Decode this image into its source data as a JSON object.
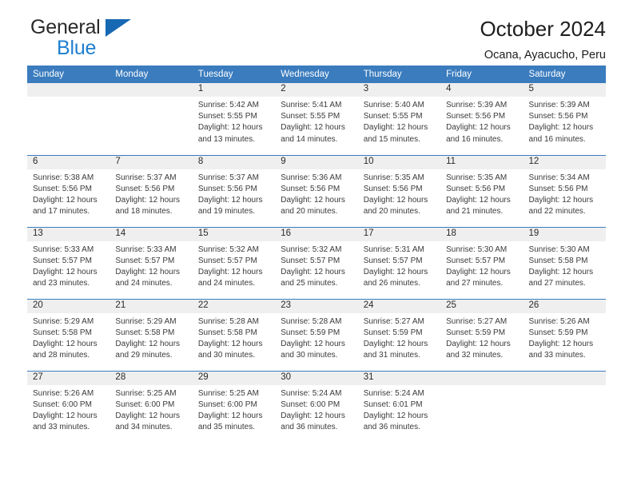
{
  "brand": {
    "name_top": "General",
    "name_bottom": "Blue",
    "triangle_color": "#1668b3",
    "blue_color": "#1f7fd0"
  },
  "header": {
    "title": "October 2024",
    "subtitle": "Ocana, Ayacucho, Peru"
  },
  "theme": {
    "header_blue": "#3a7cbe",
    "daynum_band": "#efefef",
    "text": "#3a3a3a"
  },
  "weekday_headers": [
    "Sunday",
    "Monday",
    "Tuesday",
    "Wednesday",
    "Thursday",
    "Friday",
    "Saturday"
  ],
  "labels": {
    "sunrise_prefix": "Sunrise: ",
    "sunset_prefix": "Sunset: ",
    "daylight_prefix": "Daylight: "
  },
  "weeks": [
    [
      {
        "empty": true
      },
      {
        "empty": true
      },
      {
        "day": "1",
        "sunrise": "Sunrise: 5:42 AM",
        "sunset": "Sunset: 5:55 PM",
        "daylight_1": "Daylight: 12 hours",
        "daylight_2": "and 13 minutes."
      },
      {
        "day": "2",
        "sunrise": "Sunrise: 5:41 AM",
        "sunset": "Sunset: 5:55 PM",
        "daylight_1": "Daylight: 12 hours",
        "daylight_2": "and 14 minutes."
      },
      {
        "day": "3",
        "sunrise": "Sunrise: 5:40 AM",
        "sunset": "Sunset: 5:55 PM",
        "daylight_1": "Daylight: 12 hours",
        "daylight_2": "and 15 minutes."
      },
      {
        "day": "4",
        "sunrise": "Sunrise: 5:39 AM",
        "sunset": "Sunset: 5:56 PM",
        "daylight_1": "Daylight: 12 hours",
        "daylight_2": "and 16 minutes."
      },
      {
        "day": "5",
        "sunrise": "Sunrise: 5:39 AM",
        "sunset": "Sunset: 5:56 PM",
        "daylight_1": "Daylight: 12 hours",
        "daylight_2": "and 16 minutes."
      }
    ],
    [
      {
        "day": "6",
        "sunrise": "Sunrise: 5:38 AM",
        "sunset": "Sunset: 5:56 PM",
        "daylight_1": "Daylight: 12 hours",
        "daylight_2": "and 17 minutes."
      },
      {
        "day": "7",
        "sunrise": "Sunrise: 5:37 AM",
        "sunset": "Sunset: 5:56 PM",
        "daylight_1": "Daylight: 12 hours",
        "daylight_2": "and 18 minutes."
      },
      {
        "day": "8",
        "sunrise": "Sunrise: 5:37 AM",
        "sunset": "Sunset: 5:56 PM",
        "daylight_1": "Daylight: 12 hours",
        "daylight_2": "and 19 minutes."
      },
      {
        "day": "9",
        "sunrise": "Sunrise: 5:36 AM",
        "sunset": "Sunset: 5:56 PM",
        "daylight_1": "Daylight: 12 hours",
        "daylight_2": "and 20 minutes."
      },
      {
        "day": "10",
        "sunrise": "Sunrise: 5:35 AM",
        "sunset": "Sunset: 5:56 PM",
        "daylight_1": "Daylight: 12 hours",
        "daylight_2": "and 20 minutes."
      },
      {
        "day": "11",
        "sunrise": "Sunrise: 5:35 AM",
        "sunset": "Sunset: 5:56 PM",
        "daylight_1": "Daylight: 12 hours",
        "daylight_2": "and 21 minutes."
      },
      {
        "day": "12",
        "sunrise": "Sunrise: 5:34 AM",
        "sunset": "Sunset: 5:56 PM",
        "daylight_1": "Daylight: 12 hours",
        "daylight_2": "and 22 minutes."
      }
    ],
    [
      {
        "day": "13",
        "sunrise": "Sunrise: 5:33 AM",
        "sunset": "Sunset: 5:57 PM",
        "daylight_1": "Daylight: 12 hours",
        "daylight_2": "and 23 minutes."
      },
      {
        "day": "14",
        "sunrise": "Sunrise: 5:33 AM",
        "sunset": "Sunset: 5:57 PM",
        "daylight_1": "Daylight: 12 hours",
        "daylight_2": "and 24 minutes."
      },
      {
        "day": "15",
        "sunrise": "Sunrise: 5:32 AM",
        "sunset": "Sunset: 5:57 PM",
        "daylight_1": "Daylight: 12 hours",
        "daylight_2": "and 24 minutes."
      },
      {
        "day": "16",
        "sunrise": "Sunrise: 5:32 AM",
        "sunset": "Sunset: 5:57 PM",
        "daylight_1": "Daylight: 12 hours",
        "daylight_2": "and 25 minutes."
      },
      {
        "day": "17",
        "sunrise": "Sunrise: 5:31 AM",
        "sunset": "Sunset: 5:57 PM",
        "daylight_1": "Daylight: 12 hours",
        "daylight_2": "and 26 minutes."
      },
      {
        "day": "18",
        "sunrise": "Sunrise: 5:30 AM",
        "sunset": "Sunset: 5:57 PM",
        "daylight_1": "Daylight: 12 hours",
        "daylight_2": "and 27 minutes."
      },
      {
        "day": "19",
        "sunrise": "Sunrise: 5:30 AM",
        "sunset": "Sunset: 5:58 PM",
        "daylight_1": "Daylight: 12 hours",
        "daylight_2": "and 27 minutes."
      }
    ],
    [
      {
        "day": "20",
        "sunrise": "Sunrise: 5:29 AM",
        "sunset": "Sunset: 5:58 PM",
        "daylight_1": "Daylight: 12 hours",
        "daylight_2": "and 28 minutes."
      },
      {
        "day": "21",
        "sunrise": "Sunrise: 5:29 AM",
        "sunset": "Sunset: 5:58 PM",
        "daylight_1": "Daylight: 12 hours",
        "daylight_2": "and 29 minutes."
      },
      {
        "day": "22",
        "sunrise": "Sunrise: 5:28 AM",
        "sunset": "Sunset: 5:58 PM",
        "daylight_1": "Daylight: 12 hours",
        "daylight_2": "and 30 minutes."
      },
      {
        "day": "23",
        "sunrise": "Sunrise: 5:28 AM",
        "sunset": "Sunset: 5:59 PM",
        "daylight_1": "Daylight: 12 hours",
        "daylight_2": "and 30 minutes."
      },
      {
        "day": "24",
        "sunrise": "Sunrise: 5:27 AM",
        "sunset": "Sunset: 5:59 PM",
        "daylight_1": "Daylight: 12 hours",
        "daylight_2": "and 31 minutes."
      },
      {
        "day": "25",
        "sunrise": "Sunrise: 5:27 AM",
        "sunset": "Sunset: 5:59 PM",
        "daylight_1": "Daylight: 12 hours",
        "daylight_2": "and 32 minutes."
      },
      {
        "day": "26",
        "sunrise": "Sunrise: 5:26 AM",
        "sunset": "Sunset: 5:59 PM",
        "daylight_1": "Daylight: 12 hours",
        "daylight_2": "and 33 minutes."
      }
    ],
    [
      {
        "day": "27",
        "sunrise": "Sunrise: 5:26 AM",
        "sunset": "Sunset: 6:00 PM",
        "daylight_1": "Daylight: 12 hours",
        "daylight_2": "and 33 minutes."
      },
      {
        "day": "28",
        "sunrise": "Sunrise: 5:25 AM",
        "sunset": "Sunset: 6:00 PM",
        "daylight_1": "Daylight: 12 hours",
        "daylight_2": "and 34 minutes."
      },
      {
        "day": "29",
        "sunrise": "Sunrise: 5:25 AM",
        "sunset": "Sunset: 6:00 PM",
        "daylight_1": "Daylight: 12 hours",
        "daylight_2": "and 35 minutes."
      },
      {
        "day": "30",
        "sunrise": "Sunrise: 5:24 AM",
        "sunset": "Sunset: 6:00 PM",
        "daylight_1": "Daylight: 12 hours",
        "daylight_2": "and 36 minutes."
      },
      {
        "day": "31",
        "sunrise": "Sunrise: 5:24 AM",
        "sunset": "Sunset: 6:01 PM",
        "daylight_1": "Daylight: 12 hours",
        "daylight_2": "and 36 minutes."
      },
      {
        "empty": true
      },
      {
        "empty": true
      }
    ]
  ]
}
